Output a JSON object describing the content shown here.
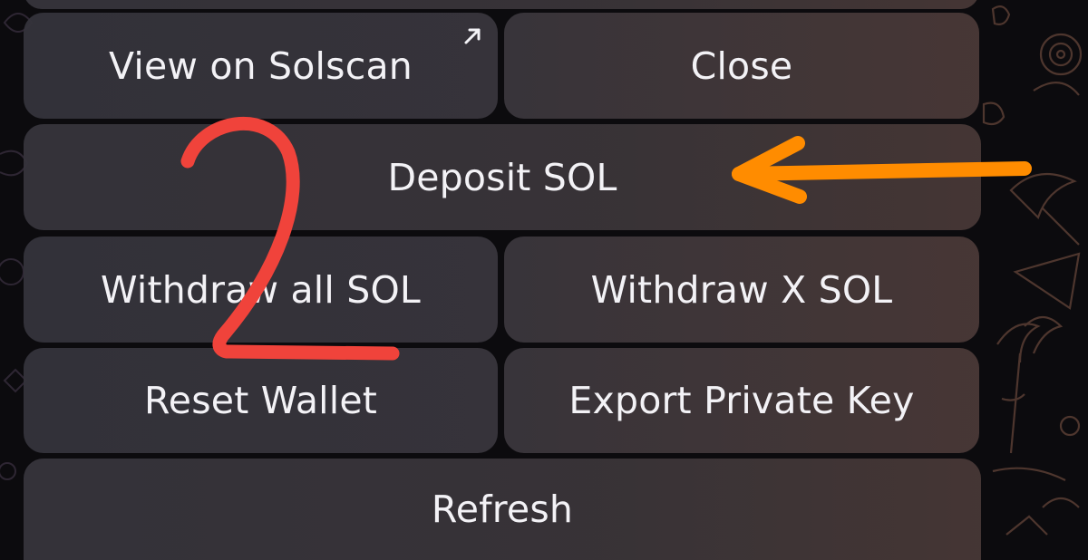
{
  "keyboard": {
    "view_solscan_label": "View on Solscan",
    "close_label": "Close",
    "deposit_label": "Deposit SOL",
    "withdraw_all_label": "Withdraw all SOL",
    "withdraw_x_label": "Withdraw X SOL",
    "reset_wallet_label": "Reset Wallet",
    "export_key_label": "Export Private Key",
    "refresh_label": "Refresh"
  },
  "annotation": {
    "step_number": "2",
    "step_color": "#f0433b",
    "arrow_color": "#ff8c00"
  },
  "colors": {
    "button_text": "#f3f2f6",
    "background": "#0c0b0e"
  },
  "icons": {
    "external_link": "arrow-up-right-icon"
  }
}
